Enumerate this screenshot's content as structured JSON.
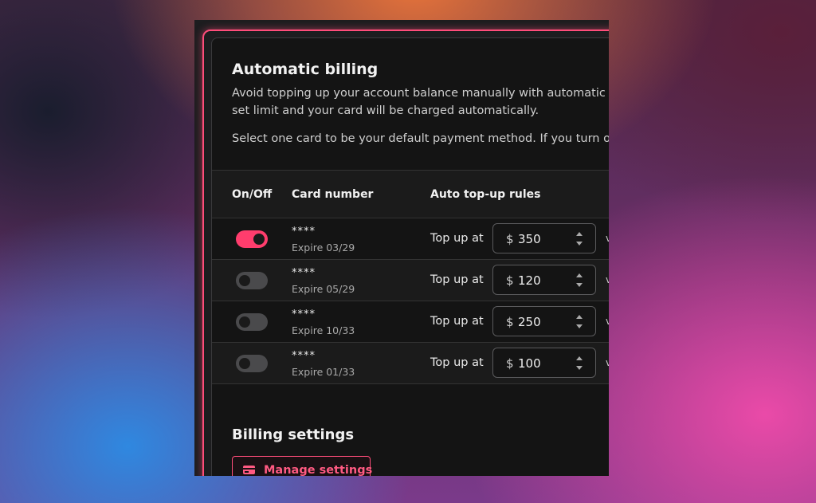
{
  "auto_billing": {
    "title": "Automatic billing",
    "description": "Avoid topping up your account balance manually with automatic billing. Your balance will be topped up when it reaches a set limit and your card will be charged automatically.",
    "description_line1": "Avoid topping up your account balance manually with automatic billi",
    "description_line2": "set limit and your card will be charged automatically.",
    "select_note": "Select one card to be your default payment method. If you turn on a n"
  },
  "table": {
    "headers": {
      "toggle": "On/Off",
      "card": "Card number",
      "rules": "Auto top-up rules"
    },
    "rows": [
      {
        "enabled": true,
        "card": "****",
        "expire": "Expire 03/29",
        "rule_label": "Top up at",
        "currency": "$",
        "amount": "350"
      },
      {
        "enabled": false,
        "card": "****",
        "expire": "Expire 05/29",
        "rule_label": "Top up at",
        "currency": "$",
        "amount": "120"
      },
      {
        "enabled": false,
        "card": "****",
        "expire": "Expire 10/33",
        "rule_label": "Top up at",
        "currency": "$",
        "amount": "250"
      },
      {
        "enabled": false,
        "card": "****",
        "expire": "Expire 01/33",
        "rule_label": "Top up at",
        "currency": "$",
        "amount": "100"
      }
    ],
    "chevron": "v"
  },
  "billing_settings": {
    "title": "Billing settings",
    "manage_button": {
      "label": "Manage settings",
      "icon": "credit-card-icon"
    }
  },
  "colors": {
    "accent": "#ff4d7a",
    "toggle_off": "#4a4a4c",
    "panel_bg": "#141414"
  }
}
